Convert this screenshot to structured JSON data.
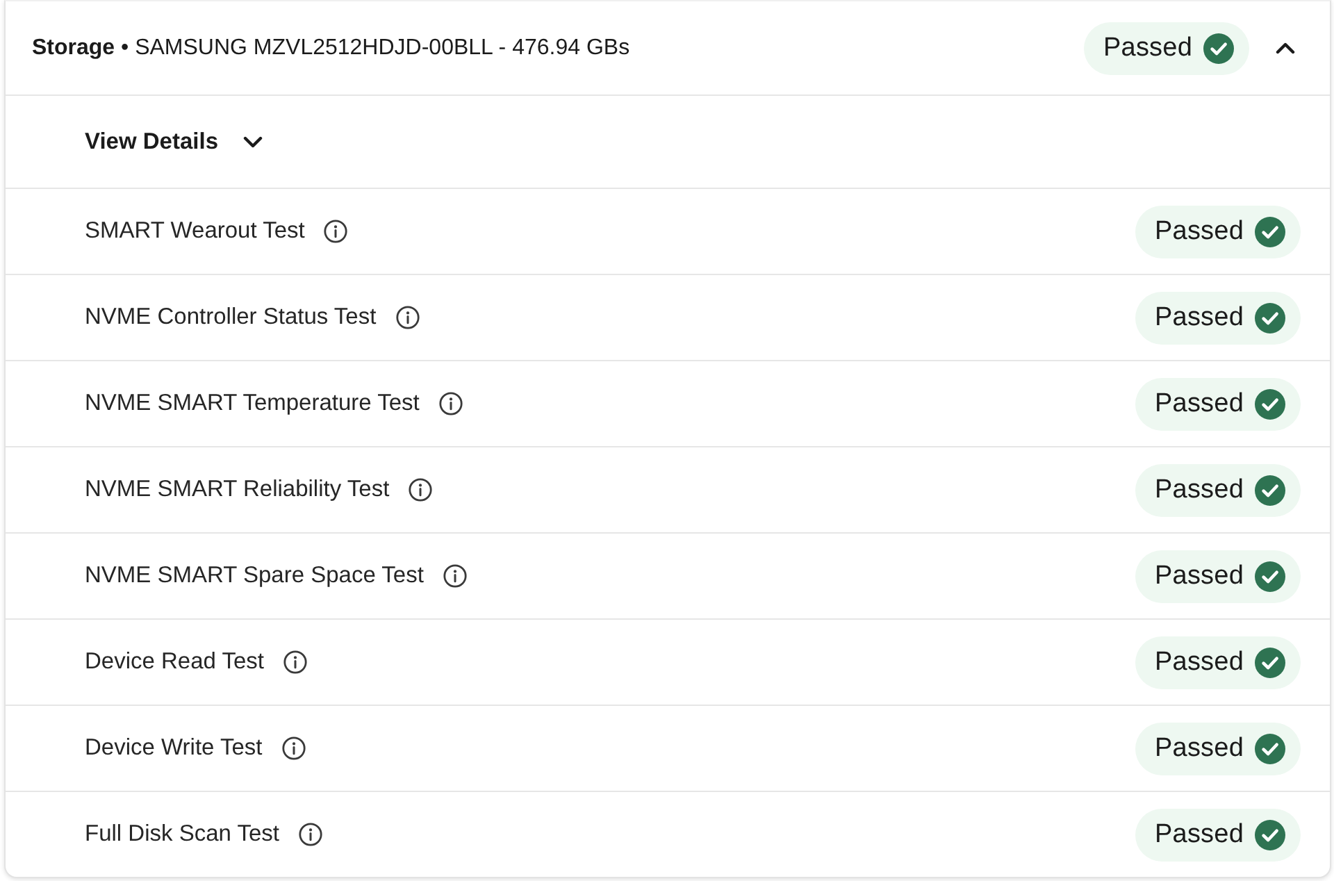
{
  "header": {
    "title": "**Storage** • SAMSUNG MZVL2512HDJD-00BLL - 476.94 GBs",
    "status": {
      "label": "Passed",
      "passed": true
    },
    "expanded": true
  },
  "details_toggle": {
    "label": "View Details",
    "expanded": false
  },
  "tests": [
    {
      "name": "SMART Wearout Test",
      "status": {
        "label": "Passed",
        "passed": true
      }
    },
    {
      "name": "NVME Controller Status Test",
      "status": {
        "label": "Passed",
        "passed": true
      }
    },
    {
      "name": "NVME SMART Temperature Test",
      "status": {
        "label": "Passed",
        "passed": true
      }
    },
    {
      "name": "NVME SMART Reliability Test",
      "status": {
        "label": "Passed",
        "passed": true
      }
    },
    {
      "name": "NVME SMART Spare Space Test",
      "status": {
        "label": "Passed",
        "passed": true
      }
    },
    {
      "name": "Device Read Test",
      "status": {
        "label": "Passed",
        "passed": true
      }
    },
    {
      "name": "Device Write Test",
      "status": {
        "label": "Passed",
        "passed": true
      }
    },
    {
      "name": "Full Disk Scan Test",
      "status": {
        "label": "Passed",
        "passed": true
      }
    }
  ]
}
